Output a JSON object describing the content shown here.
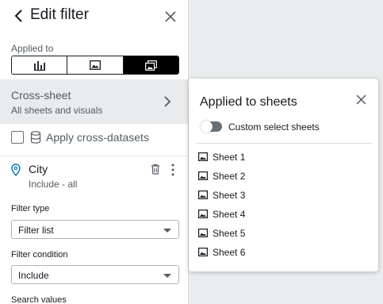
{
  "header": {
    "title": "Edit filter"
  },
  "applied_to": {
    "label": "Applied to",
    "options": [
      {
        "icon": "bar-chart-icon",
        "active": false
      },
      {
        "icon": "sheet-icon",
        "active": false
      },
      {
        "icon": "multi-sheet-icon",
        "active": true
      }
    ]
  },
  "scope": {
    "title": "Cross-sheet",
    "subtitle": "All sheets and visuals"
  },
  "apply_cross": {
    "label": "Apply cross-datasets",
    "checked": false
  },
  "field": {
    "name": "City",
    "summary": "Include - all"
  },
  "filter_type": {
    "label": "Filter type",
    "value": "Filter list"
  },
  "filter_condition": {
    "label": "Filter condition",
    "value": "Include"
  },
  "search_values": {
    "label": "Search values"
  },
  "popover": {
    "title": "Applied to sheets",
    "toggle_label": "Custom select sheets",
    "toggle_on": false,
    "sheets": [
      "Sheet 1",
      "Sheet 2",
      "Sheet 3",
      "Sheet 4",
      "Sheet 5",
      "Sheet 6"
    ]
  },
  "colors": {
    "accent": "#0073bb",
    "active_segment": "#000000",
    "scope_bg": "#e9ebed"
  }
}
